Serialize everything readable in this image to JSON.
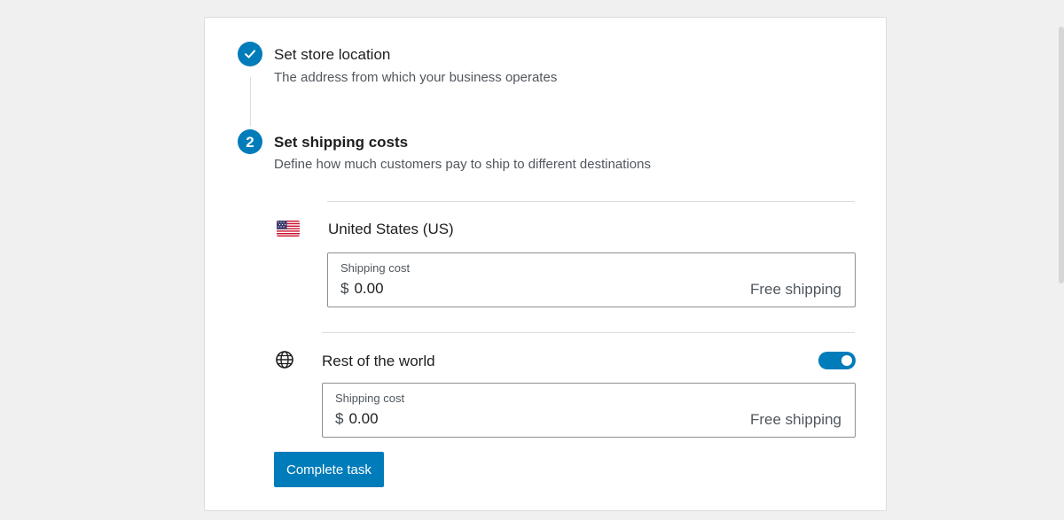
{
  "steps": [
    {
      "status": "complete",
      "icon": "checkmark-icon",
      "title": "Set store location",
      "description": "The address from which your business operates"
    },
    {
      "status": "active",
      "number": "2",
      "title": "Set shipping costs",
      "description": "Define how much customers pay to ship to different destinations"
    }
  ],
  "shipping_zones": [
    {
      "icon": "us-flag-icon",
      "name": "United States (US)",
      "cost_label": "Shipping cost",
      "currency": "$",
      "value": "0.00",
      "suffix": "Free shipping"
    },
    {
      "icon": "globe-icon",
      "name": "Rest of the world",
      "toggle_on": true,
      "cost_label": "Shipping cost",
      "currency": "$",
      "value": "0.00",
      "suffix": "Free shipping"
    }
  ],
  "actions": {
    "complete_label": "Complete task"
  },
  "colors": {
    "accent": "#007cba",
    "background": "#f0f0f1",
    "card": "#ffffff",
    "border": "#dcdcde",
    "muted_text": "#50575e"
  }
}
